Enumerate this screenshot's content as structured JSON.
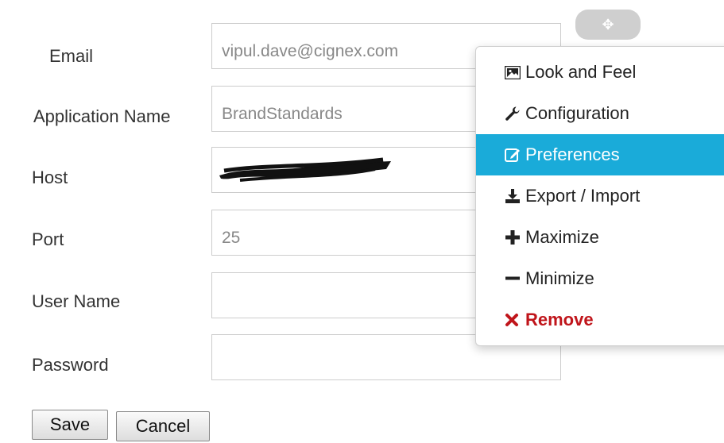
{
  "form": {
    "email": {
      "label": "Email",
      "value": "vipul.dave@cignex.com"
    },
    "app_name": {
      "label": "Application Name",
      "value": "BrandStandards"
    },
    "host": {
      "label": "Host",
      "value": ""
    },
    "port": {
      "label": "Port",
      "value": "25"
    },
    "user_name": {
      "label": "User Name",
      "value": ""
    },
    "password": {
      "label": "Password",
      "value": ""
    }
  },
  "buttons": {
    "save": "Save",
    "cancel": "Cancel"
  },
  "move_handle": {
    "icon": "move-icon",
    "glyph": "✥"
  },
  "menu": {
    "items": [
      {
        "label": "Look and Feel",
        "icon": "image-icon"
      },
      {
        "label": "Configuration",
        "icon": "wrench-icon"
      },
      {
        "label": "Preferences",
        "icon": "edit-icon",
        "active": true
      },
      {
        "label": "Export / Import",
        "icon": "download-icon"
      },
      {
        "label": "Maximize",
        "icon": "plus-icon"
      },
      {
        "label": "Minimize",
        "icon": "minus-icon"
      },
      {
        "label": "Remove",
        "icon": "remove-icon",
        "danger": true
      }
    ]
  },
  "colors": {
    "active_bg": "#1aabd9",
    "danger": "#c0151b",
    "handle": "#cfcfcf"
  }
}
